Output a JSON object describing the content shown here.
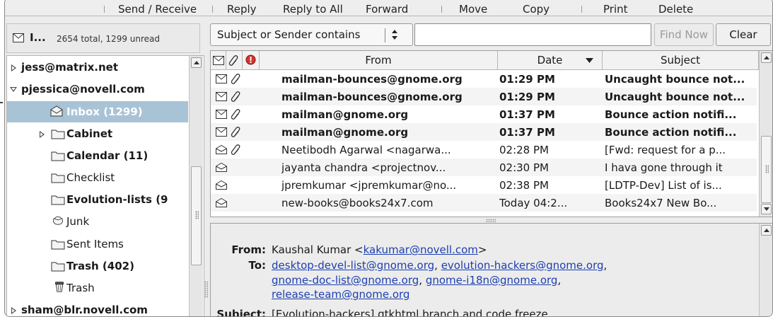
{
  "toolbar": {
    "send_receive": "Send / Receive",
    "reply": "Reply",
    "reply_all": "Reply to All",
    "forward": "Forward",
    "move": "Move",
    "copy": "Copy",
    "print": "Print",
    "delete": "Delete"
  },
  "folder_header": {
    "name": "I...",
    "count": "2654 total, 1299 unread"
  },
  "tree": {
    "account1": "jess@matrix.net",
    "account2": "pjessica@novell.com",
    "inbox": "Inbox (1299)",
    "cabinet": "Cabinet",
    "calendar": "Calendar (11)",
    "checklist": "Checklist",
    "evolution_lists": "Evolution-lists (9",
    "junk": "Junk",
    "sent": "Sent Items",
    "trash_count": "Trash (402)",
    "trash": "Trash",
    "account3": "sham@blr.novell.com"
  },
  "search": {
    "scope": "Subject or Sender contains",
    "query": "",
    "find_now": "Find Now",
    "clear": "Clear"
  },
  "list": {
    "columns": {
      "from": "From",
      "date": "Date",
      "subject": "Subject"
    },
    "rows": [
      {
        "from": "mailman-bounces@gnome.org",
        "date": "01:29 PM",
        "subject": "Uncaught bounce not...",
        "unread": true,
        "attach": true
      },
      {
        "from": "mailman-bounces@gnome.org",
        "date": "01:29 PM",
        "subject": "Uncaught bounce not...",
        "unread": true,
        "attach": true
      },
      {
        "from": "mailman@gnome.org",
        "date": "01:37 PM",
        "subject": "Bounce action notifi...",
        "unread": true,
        "attach": true
      },
      {
        "from": "mailman@gnome.org",
        "date": "01:37 PM",
        "subject": "Bounce action notifi...",
        "unread": true,
        "attach": true
      },
      {
        "from": "Neetibodh Agarwal <nagarwa...",
        "date": "02:28 PM",
        "subject": "[Fwd: request for a p...",
        "unread": false,
        "attach": true
      },
      {
        "from": "jayanta chandra <projectnov...",
        "date": "02:30 PM",
        "subject": "I hava gone through it",
        "unread": false,
        "attach": false
      },
      {
        "from": "jpremkumar <jpremkumar@no...",
        "date": "02:38 PM",
        "subject": "[LDTP-Dev] List of is...",
        "unread": false,
        "attach": false
      },
      {
        "from": "new-books@books24x7.com",
        "date": "Today 04:2...",
        "subject": "Books24x7 New Bo...",
        "unread": false,
        "attach": false
      }
    ]
  },
  "preview": {
    "from_label": "From:",
    "from_name": "Kaushal Kumar <",
    "from_email": "kakumar@novell.com",
    "from_close": ">",
    "to_label": "To:",
    "to_1": "desktop-devel-list@gnome.org",
    "to_2": "evolution-hackers@gnome.org",
    "to_3": "gnome-doc-list@gnome.org",
    "to_4": "gnome-i18n@gnome.org",
    "to_5": "release-team@gnome.org",
    "sep": ", ",
    "subject_label": "Subject:",
    "subject_value": "[Evolution-hackers] gtkhtml branch and code freeze"
  },
  "colors": {
    "selection": "#a9c3d6",
    "link": "#1c3fb0",
    "window_bg": "#ececec"
  }
}
